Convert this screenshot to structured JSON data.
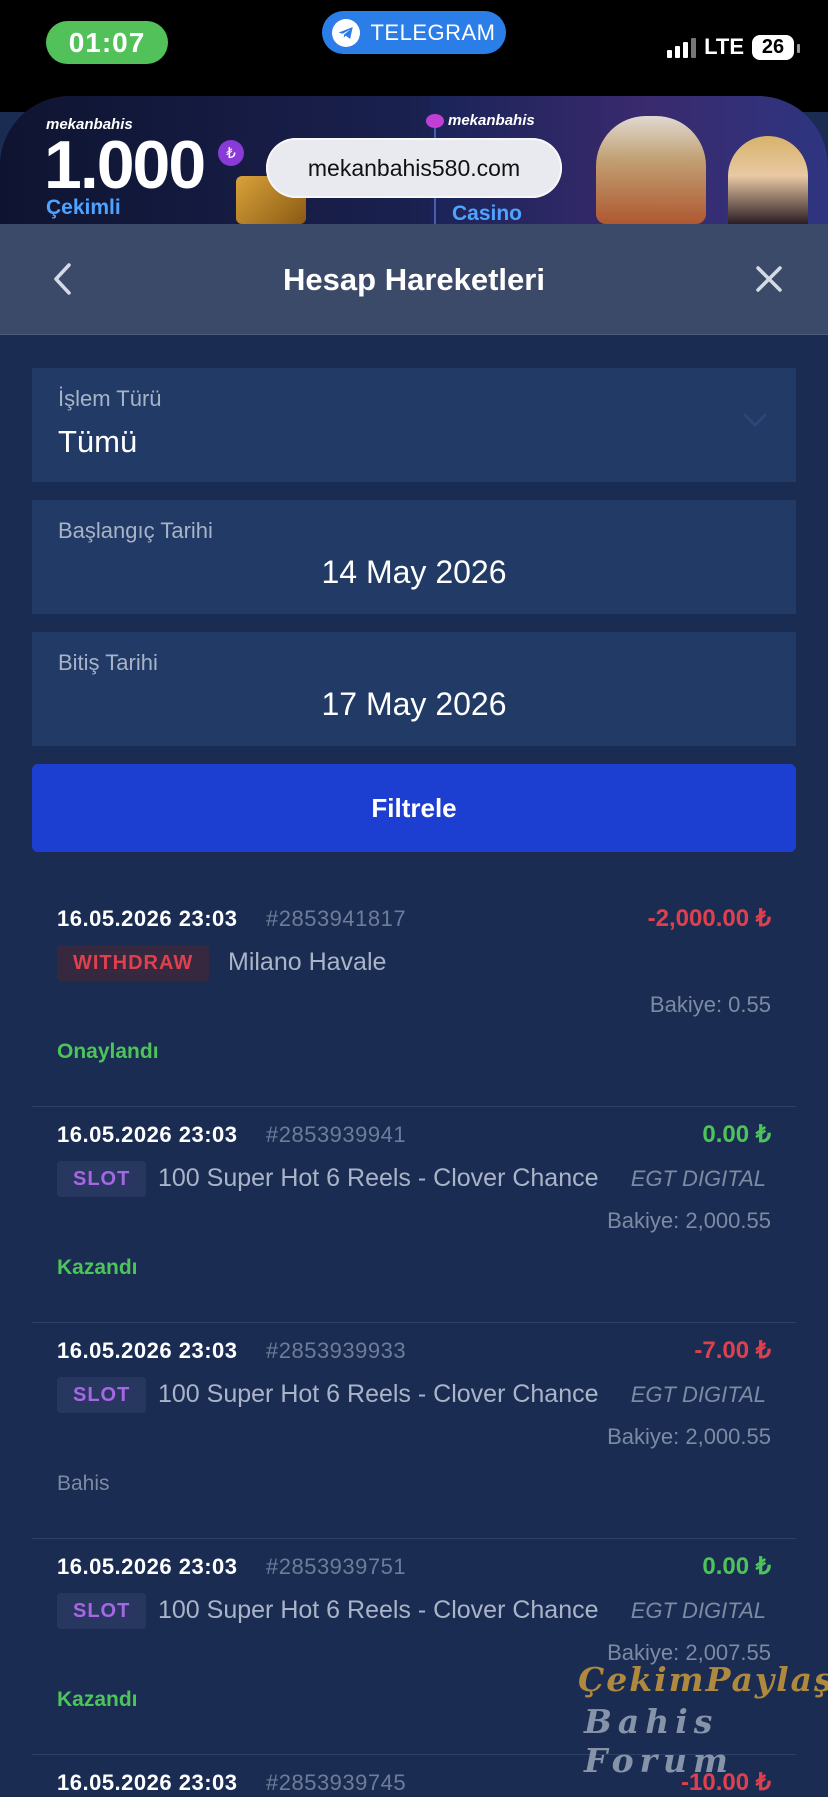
{
  "status_bar": {
    "time": "01:07",
    "telegram_label": "TELEGRAM",
    "network": "LTE",
    "battery": "26"
  },
  "banner": {
    "brand_left": "mekanbahis",
    "brand_right": "mekanbahis",
    "amount": "1.000",
    "currency_badge": "₺",
    "left_caption": "Çekimli",
    "right_caption": "Casino",
    "url": "mekanbahis580.com"
  },
  "header": {
    "title": "Hesap Hareketleri"
  },
  "filters": {
    "type_label": "İşlem Türü",
    "type_value": "Tümü",
    "start_label": "Başlangıç Tarihi",
    "start_value": "14 May 2026",
    "end_label": "Bitiş Tarihi",
    "end_value": "17 May 2026",
    "filter_button": "Filtrele"
  },
  "transactions": [
    {
      "date": "16.05.2026 23:03",
      "id": "#2853941817",
      "amount": "-2,000.00 ₺",
      "tag": "WITHDRAW",
      "description": "Milano Havale",
      "provider": "",
      "balance": "Bakiye: 0.55",
      "status": "Onaylandı"
    },
    {
      "date": "16.05.2026 23:03",
      "id": "#2853939941",
      "amount": "0.00 ₺",
      "tag": "SLOT",
      "description": "100 Super Hot 6 Reels - Clover Chance",
      "provider": "EGT DIGITAL",
      "balance": "Bakiye: 2,000.55",
      "status": "Kazandı"
    },
    {
      "date": "16.05.2026 23:03",
      "id": "#2853939933",
      "amount": "-7.00 ₺",
      "tag": "SLOT",
      "description": "100 Super Hot 6 Reels - Clover Chance",
      "provider": "EGT DIGITAL",
      "balance": "Bakiye: 2,000.55",
      "status": "Bahis"
    },
    {
      "date": "16.05.2026 23:03",
      "id": "#2853939751",
      "amount": "0.00 ₺",
      "tag": "SLOT",
      "description": "100 Super Hot 6 Reels - Clover Chance",
      "provider": "EGT DIGITAL",
      "balance": "Bakiye: 2,007.55",
      "status": "Kazandı"
    },
    {
      "date": "16.05.2026 23:03",
      "id": "#2853939745",
      "amount": "-10.00 ₺",
      "tag": "",
      "description": "",
      "provider": "",
      "balance": "",
      "status": ""
    }
  ],
  "watermark": {
    "line1": "ÇekimPaylaş",
    "line2": "Bahis Forum"
  },
  "colors": {
    "background": "#1a2c52",
    "field": "#213a66",
    "header": "#3a4a68",
    "filter_button": "#1d3fd1",
    "negative": "#e0404e",
    "positive": "#4cc45a",
    "slot_tag": "#a767e4",
    "neutral_status": "#7c8aa3"
  }
}
